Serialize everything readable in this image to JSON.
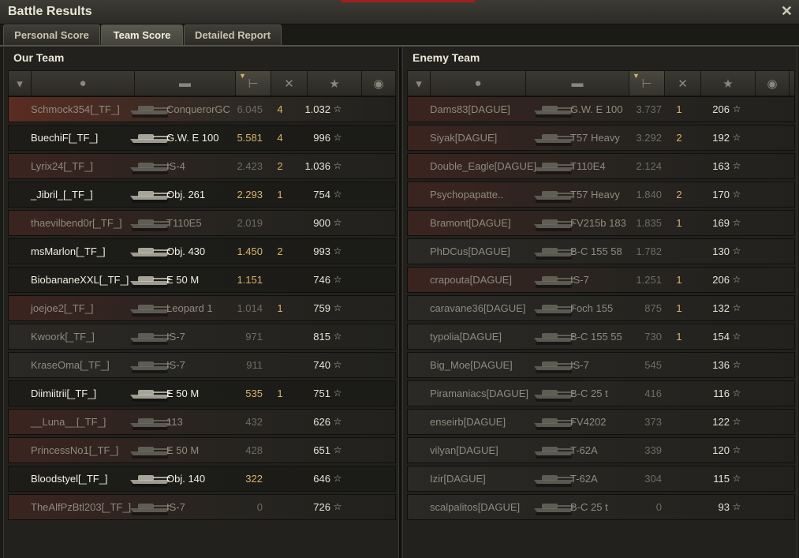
{
  "window": {
    "title": "Battle Results"
  },
  "tabs": [
    "Personal Score",
    "Team Score",
    "Detailed Report"
  ],
  "active_tab": 1,
  "our_team": {
    "title": "Our Team",
    "rows": [
      {
        "player": "Schmock354[_TF_]",
        "vehicle": "ConquerorGC",
        "damage": "6.045",
        "kills": "4",
        "xp": "1.032",
        "style": "top",
        "dmg_hi": false
      },
      {
        "player": "BuechiF[_TF_]",
        "vehicle": "G.W. E 100",
        "damage": "5.581",
        "kills": "4",
        "xp": "996",
        "style": "bright",
        "dmg_hi": true
      },
      {
        "player": "Lyrix24[_TF_]",
        "vehicle": "IS-4",
        "damage": "2.423",
        "kills": "2",
        "xp": "1.036",
        "style": "redtint",
        "dmg_hi": false
      },
      {
        "player": "_Jibril_[_TF_]",
        "vehicle": "Obj. 261",
        "damage": "2.293",
        "kills": "1",
        "xp": "754",
        "style": "bright",
        "dmg_hi": true
      },
      {
        "player": "thaevilbend0r[_TF_]",
        "vehicle": "T110E5",
        "damage": "2.019",
        "kills": "",
        "xp": "900",
        "style": "redtint",
        "dmg_hi": false
      },
      {
        "player": "msMarlon[_TF_]",
        "vehicle": "Obj. 430",
        "damage": "1.450",
        "kills": "2",
        "xp": "993",
        "style": "bright",
        "dmg_hi": true
      },
      {
        "player": "BiobananeXXL[_TF_]",
        "vehicle": "E 50 M",
        "damage": "1.151",
        "kills": "",
        "xp": "746",
        "style": "bright",
        "dmg_hi": true
      },
      {
        "player": "joejoe2[_TF_]",
        "vehicle": "Leopard 1",
        "damage": "1.014",
        "kills": "1",
        "xp": "759",
        "style": "redtint",
        "dmg_hi": false
      },
      {
        "player": "Kwoork[_TF_]",
        "vehicle": "IS-7",
        "damage": "971",
        "kills": "",
        "xp": "815",
        "style": "normal",
        "dmg_hi": false
      },
      {
        "player": "KraseOma[_TF_]",
        "vehicle": "IS-7",
        "damage": "911",
        "kills": "",
        "xp": "740",
        "style": "normal",
        "dmg_hi": false
      },
      {
        "player": "Diimiitrii[_TF_]",
        "vehicle": "E 50 M",
        "damage": "535",
        "kills": "1",
        "xp": "751",
        "style": "bright",
        "dmg_hi": true
      },
      {
        "player": "__Luna__[_TF_]",
        "vehicle": "113",
        "damage": "432",
        "kills": "",
        "xp": "626",
        "style": "redtint",
        "dmg_hi": false
      },
      {
        "player": "PrincessNo1[_TF_]",
        "vehicle": "E 50 M",
        "damage": "428",
        "kills": "",
        "xp": "651",
        "style": "redtint",
        "dmg_hi": false
      },
      {
        "player": "Bloodstyel[_TF_]",
        "vehicle": "Obj. 140",
        "damage": "322",
        "kills": "",
        "xp": "646",
        "style": "bright",
        "dmg_hi": true
      },
      {
        "player": "TheAlfPzBtl203[_TF_]",
        "vehicle": "IS-7",
        "damage": "0",
        "kills": "",
        "xp": "726",
        "style": "redtint",
        "dmg_hi": false
      }
    ]
  },
  "enemy_team": {
    "title": "Enemy Team",
    "rows": [
      {
        "player": "Dams83[DAGUE]",
        "vehicle": "G.W. E 100",
        "damage": "3.737",
        "kills": "1",
        "xp": "206",
        "style": "redtint",
        "dmg_hi": false
      },
      {
        "player": "Siyak[DAGUE]",
        "vehicle": "T57 Heavy",
        "damage": "3.292",
        "kills": "2",
        "xp": "192",
        "style": "redtint",
        "dmg_hi": false
      },
      {
        "player": "Double_Eagle[DAGUE]",
        "vehicle": "T110E4",
        "damage": "2.124",
        "kills": "",
        "xp": "163",
        "style": "redtint",
        "dmg_hi": false
      },
      {
        "player": "Psychopapatte..",
        "vehicle": "T57 Heavy",
        "damage": "1.840",
        "kills": "2",
        "xp": "170",
        "style": "redtint",
        "dmg_hi": false
      },
      {
        "player": "Bramont[DAGUE]",
        "vehicle": "FV215b 183",
        "damage": "1.835",
        "kills": "1",
        "xp": "169",
        "style": "redtint",
        "dmg_hi": false
      },
      {
        "player": "PhDCus[DAGUE]",
        "vehicle": "B-C 155 58",
        "damage": "1.782",
        "kills": "",
        "xp": "130",
        "style": "normal",
        "dmg_hi": false
      },
      {
        "player": "crapouta[DAGUE]",
        "vehicle": "IS-7",
        "damage": "1.251",
        "kills": "1",
        "xp": "206",
        "style": "redtint",
        "dmg_hi": false
      },
      {
        "player": "caravane36[DAGUE]",
        "vehicle": "Foch 155",
        "damage": "875",
        "kills": "1",
        "xp": "132",
        "style": "normal",
        "dmg_hi": false
      },
      {
        "player": "typolia[DAGUE]",
        "vehicle": "B-C 155 55",
        "damage": "730",
        "kills": "1",
        "xp": "154",
        "style": "normal",
        "dmg_hi": false
      },
      {
        "player": "Big_Moe[DAGUE]",
        "vehicle": "IS-7",
        "damage": "545",
        "kills": "",
        "xp": "136",
        "style": "normal",
        "dmg_hi": false
      },
      {
        "player": "Piramaniacs[DAGUE]",
        "vehicle": "B-C 25 t",
        "damage": "416",
        "kills": "",
        "xp": "116",
        "style": "normal",
        "dmg_hi": false
      },
      {
        "player": "enseirb[DAGUE]",
        "vehicle": "FV4202",
        "damage": "373",
        "kills": "",
        "xp": "122",
        "style": "normal",
        "dmg_hi": false
      },
      {
        "player": "vilyan[DAGUE]",
        "vehicle": "T-62A",
        "damage": "339",
        "kills": "",
        "xp": "120",
        "style": "normal",
        "dmg_hi": false
      },
      {
        "player": "Izir[DAGUE]",
        "vehicle": "T-62A",
        "damage": "304",
        "kills": "",
        "xp": "115",
        "style": "normal",
        "dmg_hi": false
      },
      {
        "player": "scalpalitos[DAGUE]",
        "vehicle": "B-C 25 t",
        "damage": "0",
        "kills": "",
        "xp": "93",
        "style": "normal",
        "dmg_hi": false
      }
    ]
  },
  "column_icons": [
    "squad-icon",
    "player-icon",
    "vehicle-icon",
    "damage-icon",
    "kills-icon",
    "xp-icon",
    "medal-icon"
  ],
  "star_glyph": "☆",
  "colors": {
    "accent": "#d9b46b",
    "top_row": "#5a2c22",
    "destroyed_tint": "#3b2420"
  }
}
